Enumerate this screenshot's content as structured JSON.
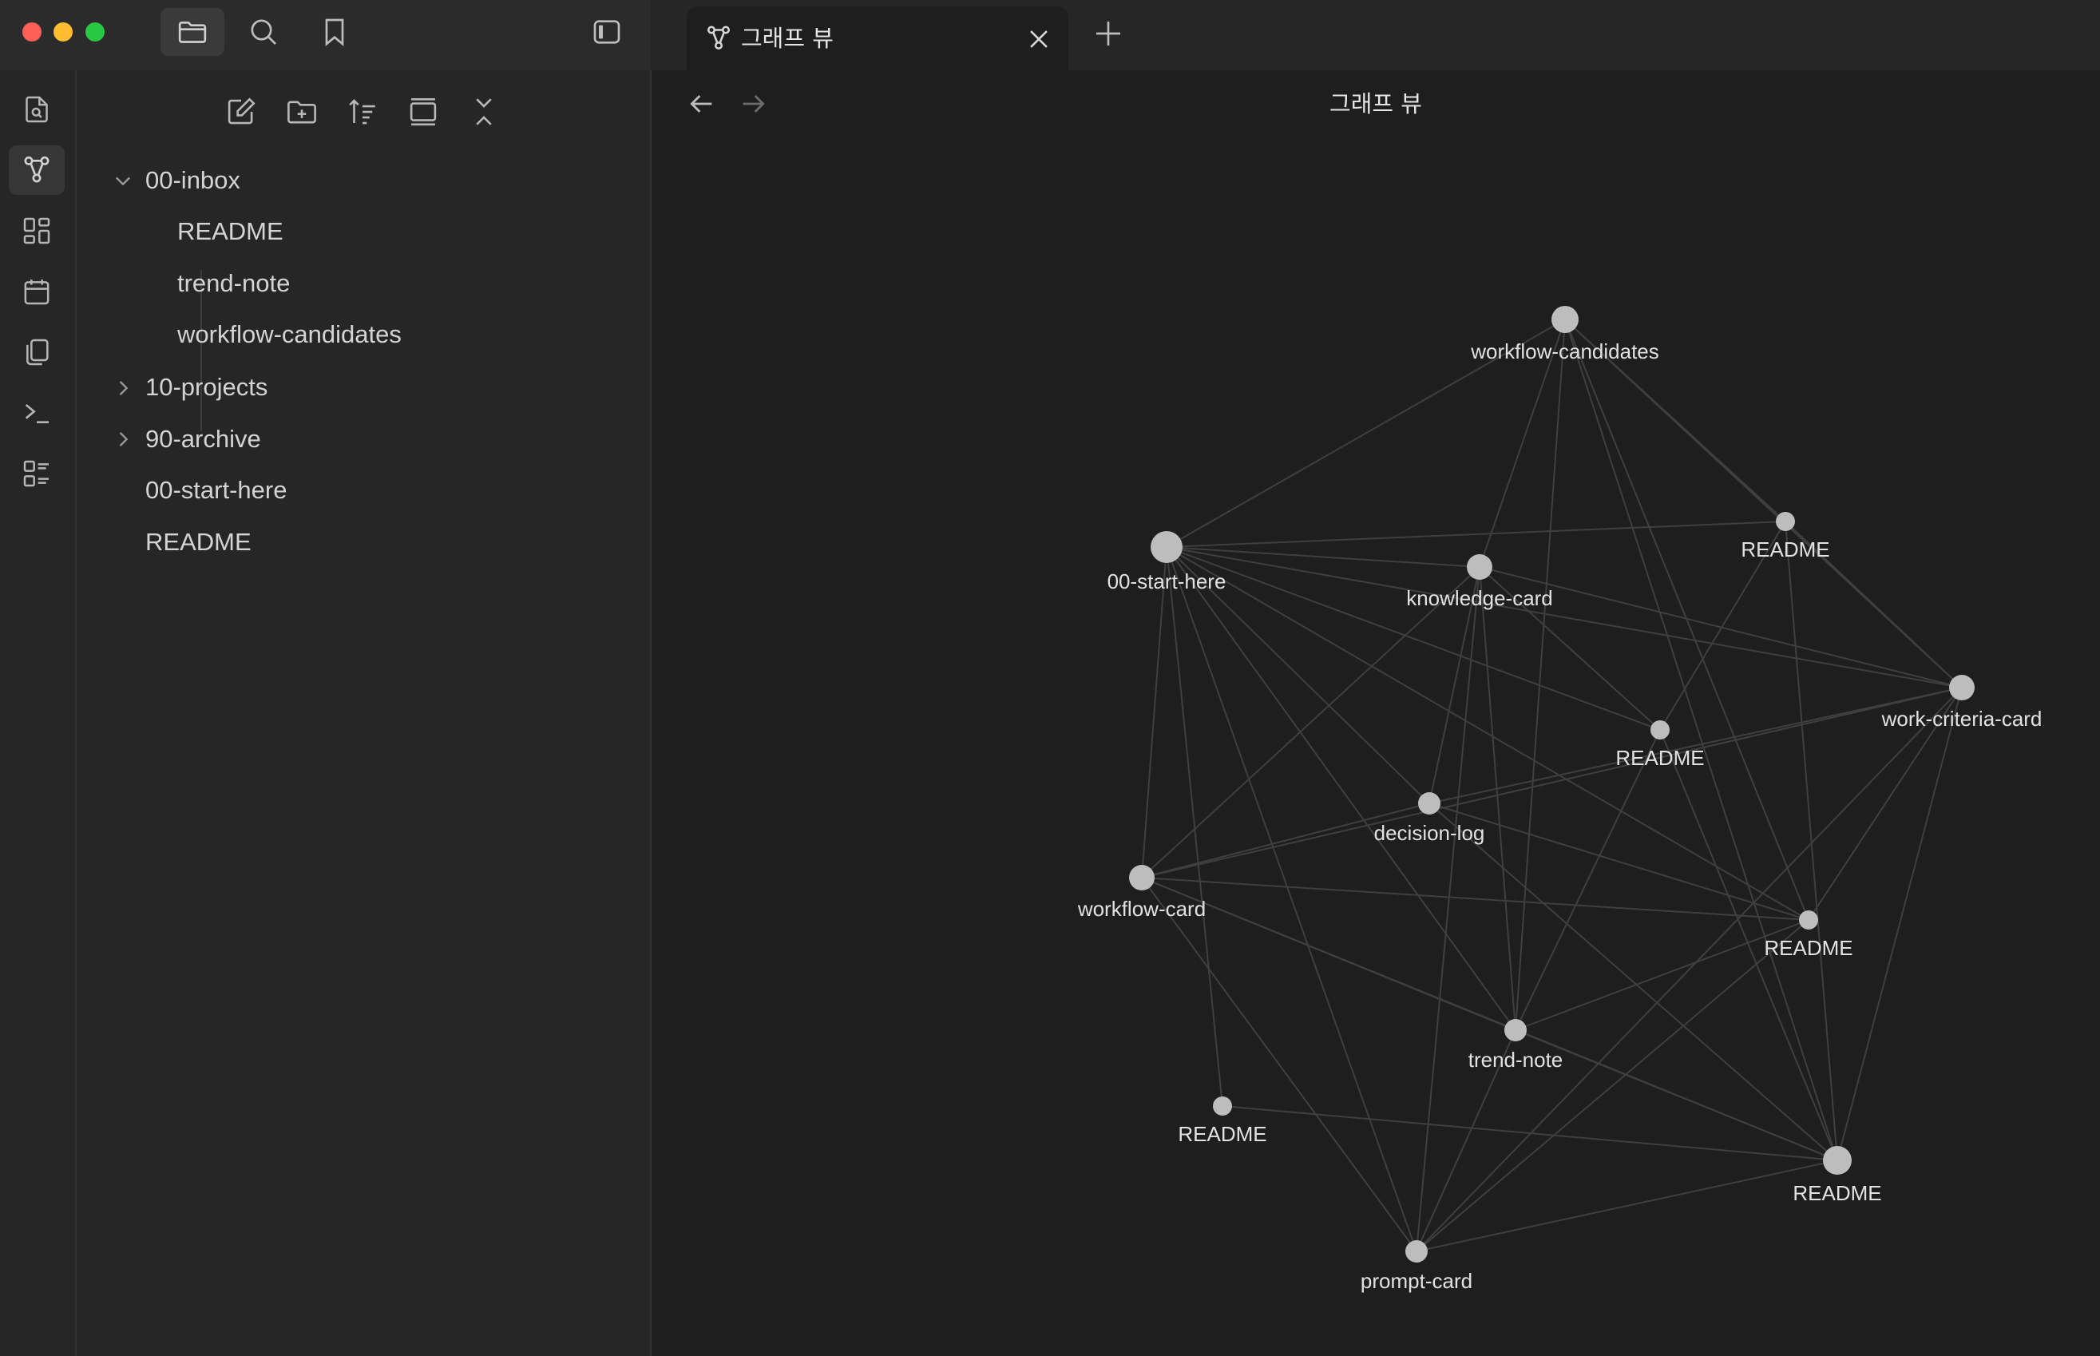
{
  "titlebar": {
    "toolbar_icons": [
      "folder-icon",
      "search-icon",
      "bookmark-icon",
      "sidebar-toggle-icon"
    ]
  },
  "tab": {
    "title": "그래프 뷰",
    "icon": "graph-icon"
  },
  "ribbon": {
    "items": [
      "quick-switcher-icon",
      "graph-icon",
      "canvas-icon",
      "daily-note-icon",
      "templates-icon",
      "command-palette-icon",
      "bases-icon"
    ],
    "active": "graph-icon"
  },
  "sidebar": {
    "tools": [
      "new-note-icon",
      "new-folder-icon",
      "sort-icon",
      "collapse-all-icon",
      "expand-all-icon"
    ],
    "tree": [
      {
        "label": "00-inbox",
        "type": "folder",
        "expanded": true
      },
      {
        "label": "README",
        "type": "file",
        "indent": 1
      },
      {
        "label": "trend-note",
        "type": "file",
        "indent": 1
      },
      {
        "label": "workflow-candidates",
        "type": "file",
        "indent": 1
      },
      {
        "label": "10-projects",
        "type": "folder",
        "expanded": false
      },
      {
        "label": "90-archive",
        "type": "folder",
        "expanded": false
      },
      {
        "label": "00-start-here",
        "type": "file",
        "indent": 0
      },
      {
        "label": "README",
        "type": "file",
        "indent": 0
      }
    ]
  },
  "main": {
    "title": "그래프 뷰",
    "nav": [
      "back-arrow-icon",
      "forward-arrow-icon"
    ]
  },
  "graph": {
    "node_color": "#bdbdbd",
    "edge_color": "#3f3f3f",
    "nodes": [
      {
        "id": "wc",
        "label": "workflow-candidates"
      },
      {
        "id": "r1",
        "label": "README"
      },
      {
        "id": "sh",
        "label": "00-start-here"
      },
      {
        "id": "kc",
        "label": "knowledge-card"
      },
      {
        "id": "wcc",
        "label": "work-criteria-card"
      },
      {
        "id": "r2",
        "label": "README"
      },
      {
        "id": "dl",
        "label": "decision-log"
      },
      {
        "id": "wf",
        "label": "workflow-card"
      },
      {
        "id": "r3",
        "label": "README"
      },
      {
        "id": "tn",
        "label": "trend-note"
      },
      {
        "id": "r4",
        "label": "README"
      },
      {
        "id": "r5",
        "label": "README"
      },
      {
        "id": "pc",
        "label": "prompt-card"
      }
    ],
    "edges": [
      [
        "wc",
        "sh"
      ],
      [
        "wc",
        "kc"
      ],
      [
        "wc",
        "r1"
      ],
      [
        "wc",
        "tn"
      ],
      [
        "wc",
        "r3"
      ],
      [
        "wc",
        "r5"
      ],
      [
        "wc",
        "wcc"
      ],
      [
        "sh",
        "r1"
      ],
      [
        "sh",
        "kc"
      ],
      [
        "sh",
        "wcc"
      ],
      [
        "sh",
        "r2"
      ],
      [
        "sh",
        "dl"
      ],
      [
        "sh",
        "wf"
      ],
      [
        "sh",
        "tn"
      ],
      [
        "sh",
        "r4"
      ],
      [
        "sh",
        "pc"
      ],
      [
        "sh",
        "r3"
      ],
      [
        "kc",
        "wf"
      ],
      [
        "kc",
        "dl"
      ],
      [
        "kc",
        "r2"
      ],
      [
        "kc",
        "tn"
      ],
      [
        "kc",
        "wcc"
      ],
      [
        "kc",
        "pc"
      ],
      [
        "r1",
        "r2"
      ],
      [
        "r1",
        "r5"
      ],
      [
        "r1",
        "wcc"
      ],
      [
        "wcc",
        "wf"
      ],
      [
        "wcc",
        "dl"
      ],
      [
        "wcc",
        "r3"
      ],
      [
        "wcc",
        "r5"
      ],
      [
        "wcc",
        "pc"
      ],
      [
        "r2",
        "tn"
      ],
      [
        "r2",
        "r5"
      ],
      [
        "dl",
        "wf"
      ],
      [
        "dl",
        "r3"
      ],
      [
        "wf",
        "r3"
      ],
      [
        "wf",
        "tn"
      ],
      [
        "wf",
        "r5"
      ],
      [
        "wf",
        "pc"
      ],
      [
        "tn",
        "r3"
      ],
      [
        "tn",
        "r5"
      ],
      [
        "tn",
        "pc"
      ],
      [
        "r4",
        "r5"
      ],
      [
        "r5",
        "pc"
      ],
      [
        "r5",
        "dl"
      ],
      [
        "r3",
        "pc"
      ]
    ]
  }
}
